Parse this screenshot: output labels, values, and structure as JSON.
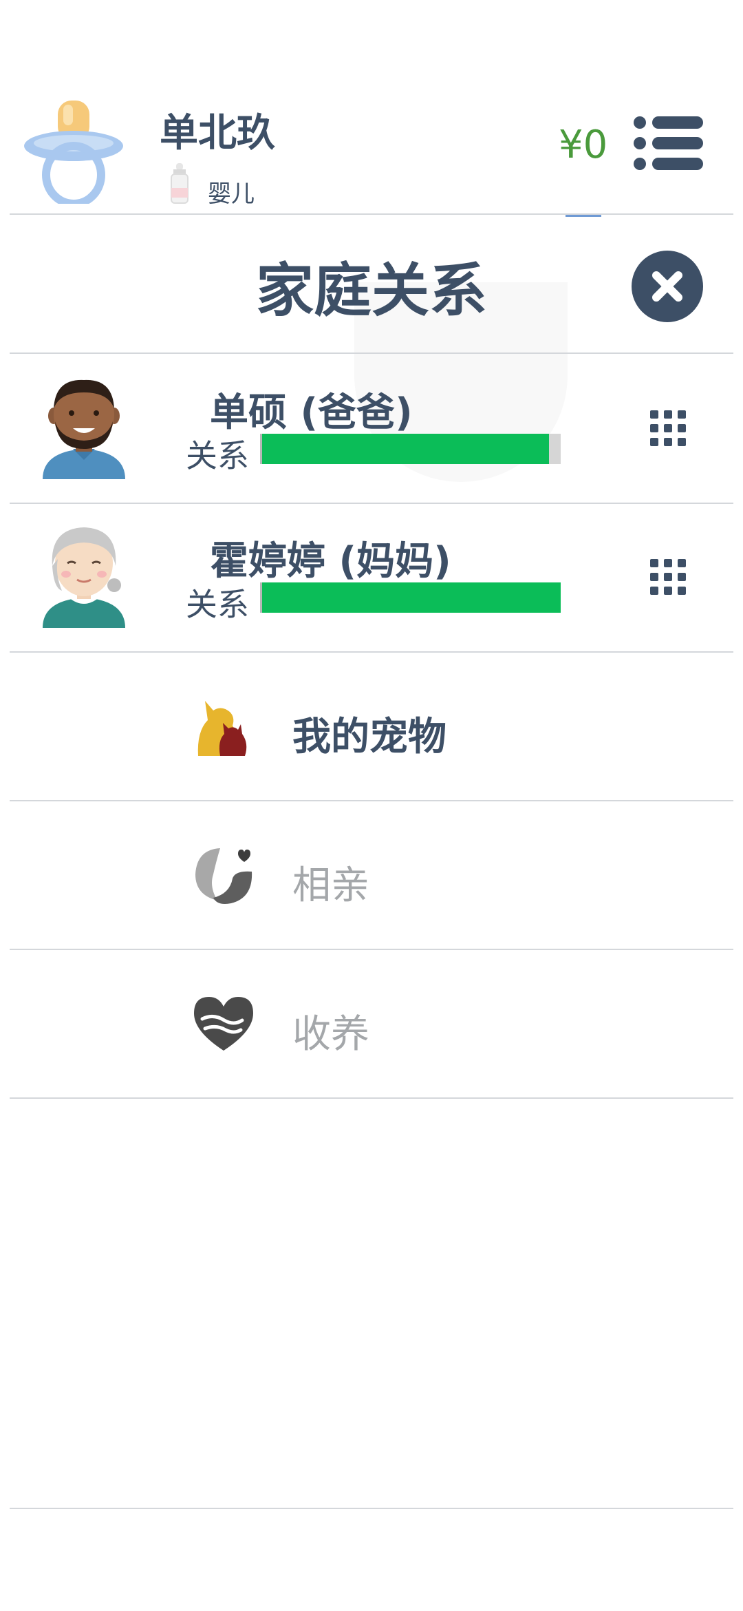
{
  "header": {
    "player_name": "单北玖",
    "life_stage": "婴儿",
    "money": "¥0"
  },
  "page": {
    "title": "家庭关系"
  },
  "relatives": [
    {
      "name": "单硕 (爸爸)",
      "relation_label": "关系",
      "relation_level": 0.96
    },
    {
      "name": "霍婷婷 (妈妈)",
      "relation_label": "关系",
      "relation_level": 1.0
    }
  ],
  "options": [
    {
      "label": "我的宠物",
      "enabled": true,
      "icon": "pet-icon"
    },
    {
      "label": "相亲",
      "enabled": false,
      "icon": "couple-icon"
    },
    {
      "label": "收养",
      "enabled": false,
      "icon": "adoption-heart-icon"
    }
  ],
  "colors": {
    "primary": "#3d4f66",
    "money": "#4a9a3c",
    "relation_bar": "#0bbd58",
    "disabled_text": "#a4a7aa"
  }
}
